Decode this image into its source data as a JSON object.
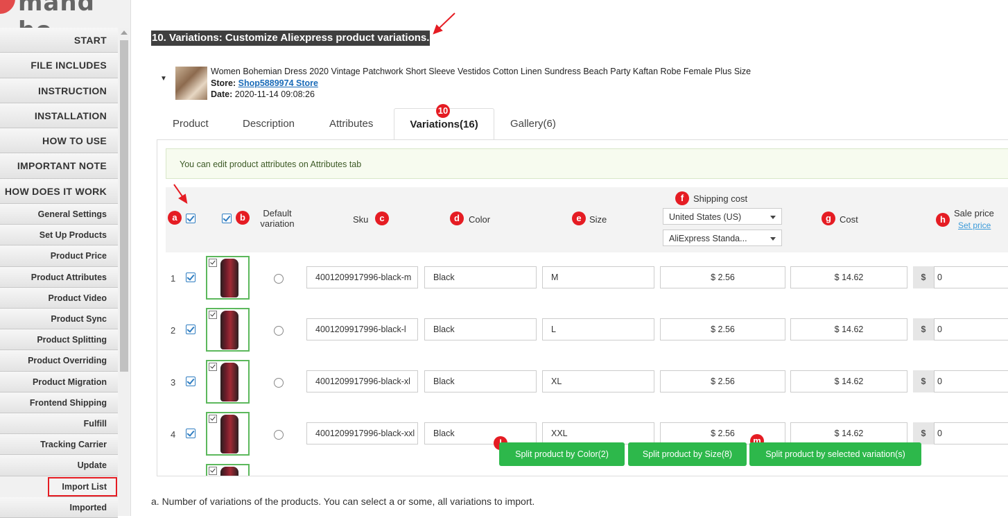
{
  "logo": {
    "text": "mand ho"
  },
  "sidebar": {
    "items": [
      {
        "label": "START",
        "size": "big"
      },
      {
        "label": "FILE INCLUDES",
        "size": "big"
      },
      {
        "label": "INSTRUCTION",
        "size": "big"
      },
      {
        "label": "INSTALLATION",
        "size": "big"
      },
      {
        "label": "HOW TO USE",
        "size": "big"
      },
      {
        "label": "IMPORTANT NOTE",
        "size": "big"
      },
      {
        "label": "HOW DOES IT WORK",
        "size": "big"
      },
      {
        "label": "General Settings",
        "size": "small"
      },
      {
        "label": "Set Up Products",
        "size": "small"
      },
      {
        "label": "Product Price",
        "size": "small"
      },
      {
        "label": "Product Attributes",
        "size": "small"
      },
      {
        "label": "Product Video",
        "size": "small"
      },
      {
        "label": "Product Sync",
        "size": "small"
      },
      {
        "label": "Product Splitting",
        "size": "small"
      },
      {
        "label": "Product Overriding",
        "size": "small"
      },
      {
        "label": "Product Migration",
        "size": "small"
      },
      {
        "label": "Frontend Shipping",
        "size": "small"
      },
      {
        "label": "Fulfill",
        "size": "small"
      },
      {
        "label": "Tracking Carrier",
        "size": "small"
      },
      {
        "label": "Update",
        "size": "small"
      },
      {
        "label": "Import List",
        "size": "small",
        "selected": true
      },
      {
        "label": "Imported",
        "size": "small"
      }
    ]
  },
  "heading": "10. Variations: Customize Aliexpress product variations.",
  "product": {
    "title": "Women Bohemian Dress 2020 Vintage Patchwork Short Sleeve Vestidos Cotton Linen Sundress Beach Party Kaftan Robe Female Plus Size",
    "store_label": "Store:",
    "store_name": "Shop5889974 Store",
    "date_label": "Date:",
    "date": "2020-11-14 09:08:26"
  },
  "tabs": {
    "product": "Product",
    "description": "Description",
    "attributes": "Attributes",
    "variations": "Variations(16)",
    "gallery": "Gallery(6)",
    "badge": "10"
  },
  "notice": "You can edit product attributes on Attributes tab",
  "table": {
    "headers": {
      "default": "Default variation",
      "sku": "Sku",
      "color": "Color",
      "size": "Size",
      "shipping": "Shipping cost",
      "cost": "Cost",
      "sale": "Sale price",
      "set_price": "Set price"
    },
    "badges": {
      "a": "a",
      "b": "b",
      "c": "c",
      "d": "d",
      "e": "e",
      "f": "f",
      "g": "g",
      "h": "h",
      "l": "l",
      "m": "m"
    },
    "country_select": "United States (US)",
    "method_select": "AliExpress Standa...",
    "rows": [
      {
        "num": "1",
        "sku": "4001209917996-black-m",
        "color": "Black",
        "size": "M",
        "shipping": "$ 2.56",
        "cost": "$ 14.62",
        "currency": "$",
        "sale": "0"
      },
      {
        "num": "2",
        "sku": "4001209917996-black-l",
        "color": "Black",
        "size": "L",
        "shipping": "$ 2.56",
        "cost": "$ 14.62",
        "currency": "$",
        "sale": "0"
      },
      {
        "num": "3",
        "sku": "4001209917996-black-xl",
        "color": "Black",
        "size": "XL",
        "shipping": "$ 2.56",
        "cost": "$ 14.62",
        "currency": "$",
        "sale": "0"
      },
      {
        "num": "4",
        "sku": "4001209917996-black-xxl",
        "color": "Black",
        "size": "XXL",
        "shipping": "$ 2.56",
        "cost": "$ 14.62",
        "currency": "$",
        "sale": "0"
      }
    ]
  },
  "buttons": {
    "split_color": "Split product by Color(2)",
    "split_size": "Split product by Size(8)",
    "split_selected": "Split product by selected variation(s)"
  },
  "footer": "a. Number of variations of the products. You can select a or some, all variations to import.",
  "colors": {
    "accent_red": "#e51c23",
    "button_green": "#2db84b",
    "checkbox_blue": "#2f7dc1"
  }
}
